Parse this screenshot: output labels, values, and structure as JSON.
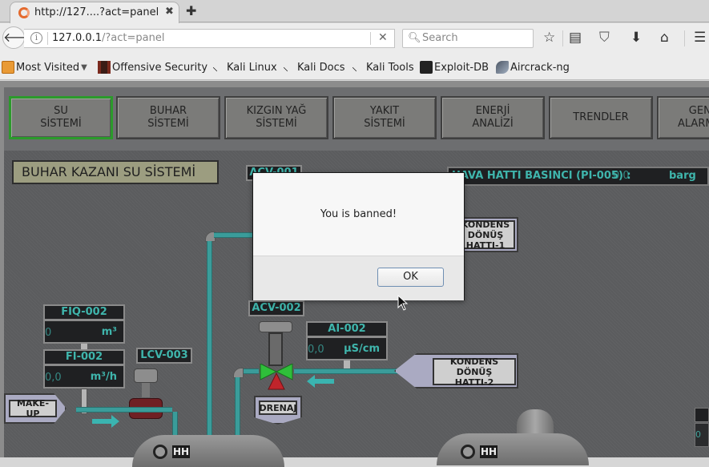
{
  "browser": {
    "tab": {
      "title": "http://127....?act=panel",
      "close_icon": "close-icon"
    },
    "new_tab_icon": "plus-icon",
    "url": {
      "host": "127.0.0.1",
      "path": "/?act=panel"
    },
    "search_placeholder": "Search",
    "toolbar_icons": [
      "star-icon",
      "reading-list-icon",
      "pocket-icon",
      "download-icon",
      "home-icon",
      "menu-icon"
    ],
    "bookmarks": [
      {
        "label": "Most Visited",
        "icon": "folder-icon",
        "dropdown": true
      },
      {
        "label": "Offensive Security",
        "icon": "offsec-icon"
      },
      {
        "label": "Kali Linux",
        "icon": "kali-icon"
      },
      {
        "label": "Kali Docs",
        "icon": "kali-icon"
      },
      {
        "label": "Kali Tools",
        "icon": "kali-icon"
      },
      {
        "label": "Exploit-DB",
        "icon": "exploitdb-icon"
      },
      {
        "label": "Aircrack-ng",
        "icon": "aircrack-icon"
      }
    ]
  },
  "hmi": {
    "nav": [
      {
        "label": "SU\nSİSTEMİ",
        "active": true
      },
      {
        "label": "BUHAR\nSİSTEMİ"
      },
      {
        "label": "KIZGIN YAĞ\nSİSTEMİ"
      },
      {
        "label": "YAKIT\nSİSTEMİ"
      },
      {
        "label": "ENERJİ\nANALİZİ"
      },
      {
        "label": "TRENDLER"
      },
      {
        "label": "GENEL\nALARMLAR"
      }
    ],
    "title": "BUHAR KAZANI SU SİSTEMİ",
    "pressure": {
      "label": "HAVA HATTI BASINCI (PI-005) :",
      "value": "0,0",
      "unit": "barg"
    },
    "acv001": {
      "tag": "ACV-001"
    },
    "fiq002": {
      "tag": "FIQ-002",
      "value": "0",
      "unit": "m³"
    },
    "fi002": {
      "tag": "FI-002",
      "value": "0,0",
      "unit": "m³/h"
    },
    "lcv003": {
      "tag": "LCV-003"
    },
    "acv002": {
      "tag": "ACV-002"
    },
    "ai002": {
      "tag": "AI-002",
      "value": "0,0",
      "unit": "µS/cm"
    },
    "makeup": {
      "label": "MAKE-UP"
    },
    "drenaj": {
      "label": "DRENAJ"
    },
    "kondens1": {
      "label": "KONDENS DÖNÜŞ\nHATTI-1"
    },
    "kondens2": {
      "label": "KONDENS DÖNÜŞ\nHATTI-2"
    },
    "hh_badge": "HH",
    "right_value": "0",
    "colors": {
      "accent": "#3fb5ac",
      "active_nav": "#2b9a2b",
      "pipe": "#3a9c9a",
      "valve_green": "#2fbf3a",
      "valve_red": "#c0242b"
    }
  },
  "dialog": {
    "message": "You is banned!",
    "ok_label": "OK"
  }
}
